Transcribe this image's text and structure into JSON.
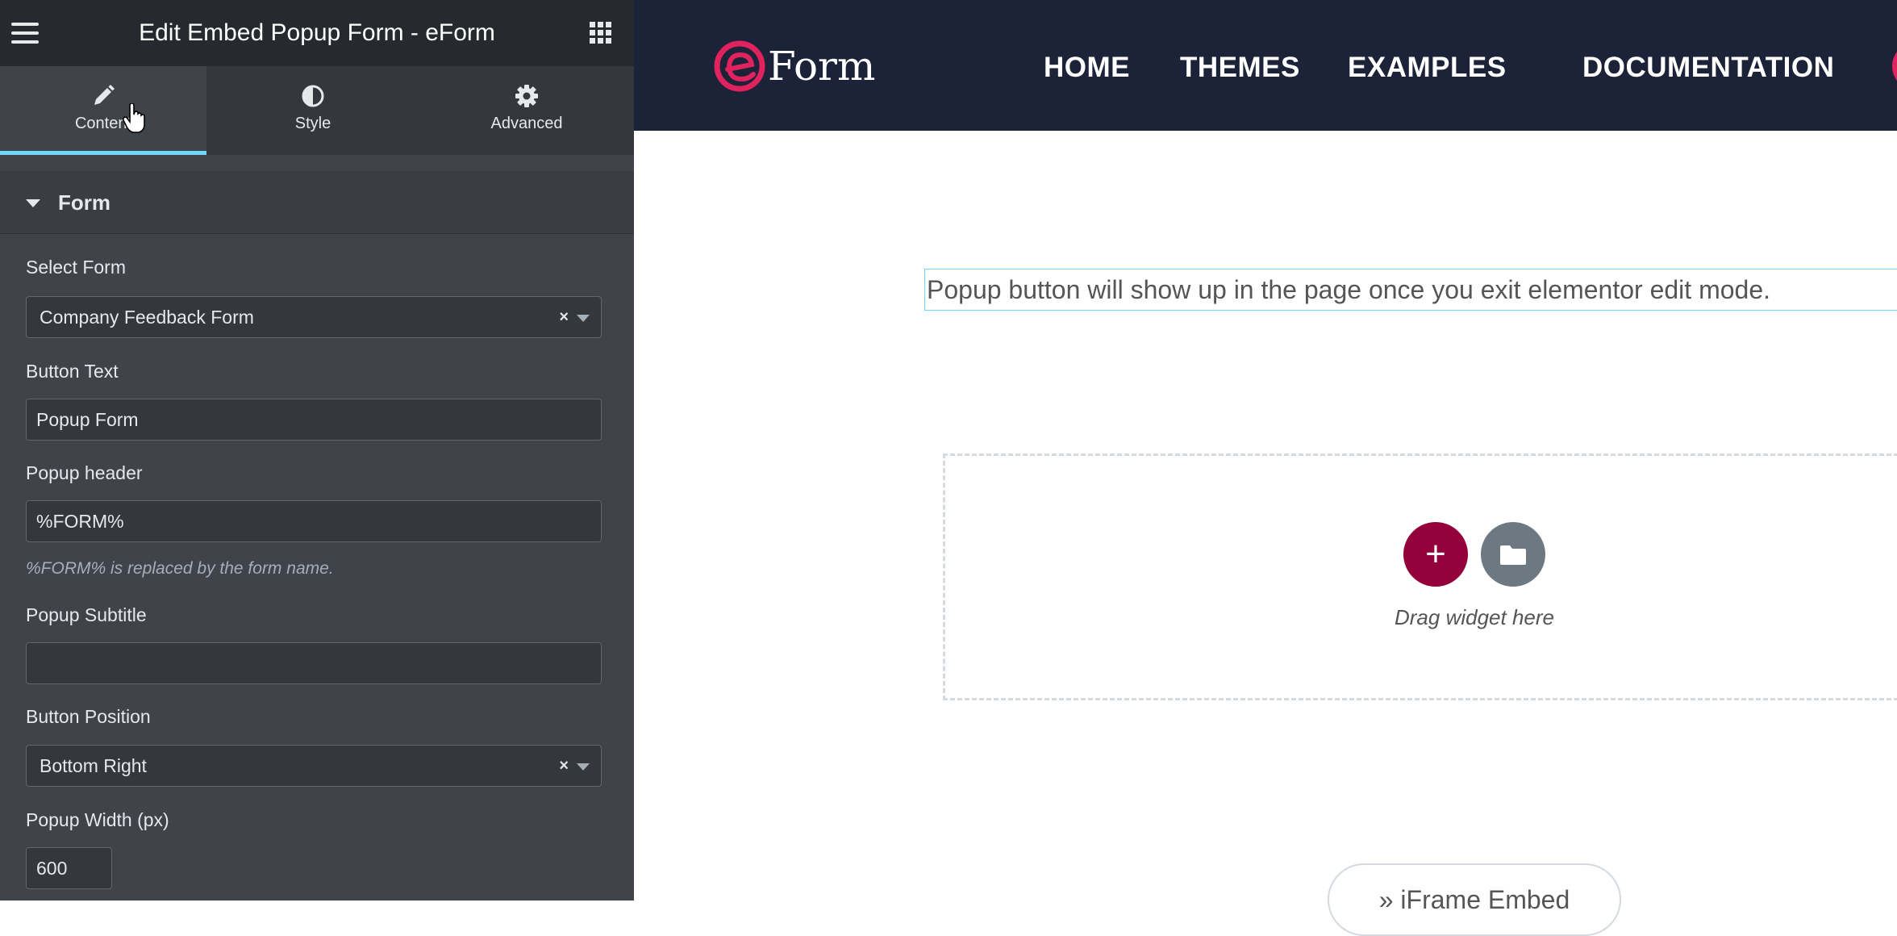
{
  "panel": {
    "title": "Edit Embed Popup Form - eForm",
    "tabs": [
      {
        "label": "Content",
        "icon": "pencil-icon",
        "active": true
      },
      {
        "label": "Style",
        "icon": "half-circle-icon",
        "active": false
      },
      {
        "label": "Advanced",
        "icon": "gear-icon",
        "active": false
      }
    ],
    "section": {
      "title": "Form",
      "expanded": true
    },
    "controls": {
      "select_form": {
        "label": "Select Form",
        "value": "Company Feedback Form",
        "clear": "×"
      },
      "button_text": {
        "label": "Button Text",
        "value": "Popup Form"
      },
      "popup_header": {
        "label": "Popup header",
        "value": "%FORM%",
        "hint": "%FORM% is replaced by the form name."
      },
      "popup_subtitle": {
        "label": "Popup Subtitle",
        "value": ""
      },
      "button_position": {
        "label": "Button Position",
        "value": "Bottom Right",
        "clear": "×"
      },
      "popup_width": {
        "label": "Popup Width (px)",
        "value": "600"
      }
    }
  },
  "site": {
    "logo_text": "Form",
    "nav": [
      "HOME",
      "THEMES",
      "EXAMPLES",
      "DOCUMENTATION"
    ]
  },
  "canvas": {
    "notice": "Popup button will show up in the page once you exit elementor edit mode.",
    "drop_zone": {
      "add_label": "+",
      "drag_text": "Drag widget here"
    },
    "iframe_pill": "» iFrame Embed"
  },
  "colors": {
    "panel_bg": "#404349",
    "header_bg": "#26292d",
    "active_tab_underline": "#71d7f7",
    "site_nav_bg": "#1c2237",
    "brand_pink": "#e0225f",
    "add_button": "#93003c",
    "library_button": "#6d7882"
  }
}
